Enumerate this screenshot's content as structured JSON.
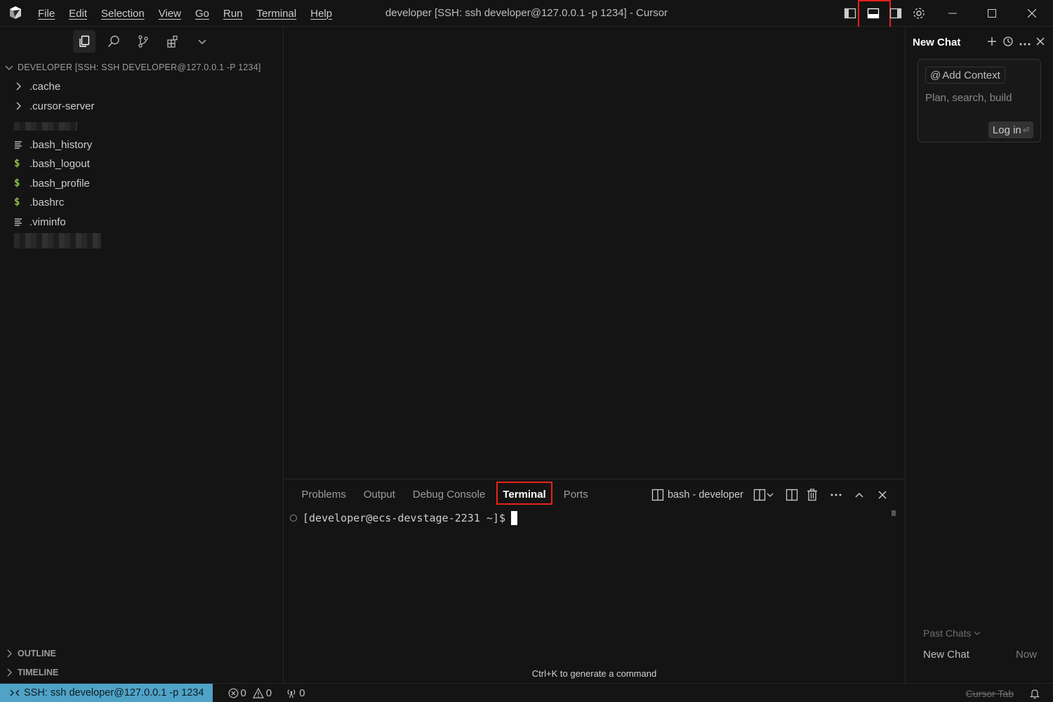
{
  "window": {
    "title": "developer [SSH: ssh developer@127.0.0.1 -p 1234] - Cursor"
  },
  "menu": [
    "File",
    "Edit",
    "Selection",
    "View",
    "Go",
    "Run",
    "Terminal",
    "Help"
  ],
  "explorer": {
    "header": "DEVELOPER [SSH: SSH DEVELOPER@127.0.0.1 -P 1234]",
    "items": [
      {
        "label": ".cache",
        "icon": "chevron-right-icon"
      },
      {
        "label": ".cursor-server",
        "icon": "chevron-right-icon"
      },
      {
        "label": ".bash_history",
        "icon": "lines-file-icon"
      },
      {
        "label": ".bash_logout",
        "icon": "dollar-file-icon"
      },
      {
        "label": ".bash_profile",
        "icon": "dollar-file-icon"
      },
      {
        "label": ".bashrc",
        "icon": "dollar-file-icon"
      },
      {
        "label": ".viminfo",
        "icon": "lines-file-icon"
      }
    ],
    "sections": {
      "outline": "OUTLINE",
      "timeline": "TIMELINE"
    }
  },
  "panel": {
    "tabs": [
      "Problems",
      "Output",
      "Debug Console",
      "Terminal",
      "Ports"
    ],
    "active_tab": "Terminal",
    "terminal_name": "bash - developer",
    "prompt": "[developer@ecs-devstage-2231 ~]$",
    "hint": "Ctrl+K to generate a command"
  },
  "chat": {
    "title": "New Chat",
    "add_context": "Add Context",
    "placeholder": "Plan, search, build",
    "login": "Log in",
    "past_chats": "Past Chats",
    "past_item": {
      "title": "New Chat",
      "time": "Now"
    }
  },
  "statusbar": {
    "remote": "SSH: ssh developer@127.0.0.1 -p 1234",
    "errors": "0",
    "warnings": "0",
    "ports": "0",
    "cursor_tab": "Cursor Tab"
  },
  "colors": {
    "background": "#141414",
    "accent_highlight": "#e8211b",
    "remote_badge": "#4fa3c7",
    "shell_file": "#8dc149"
  }
}
